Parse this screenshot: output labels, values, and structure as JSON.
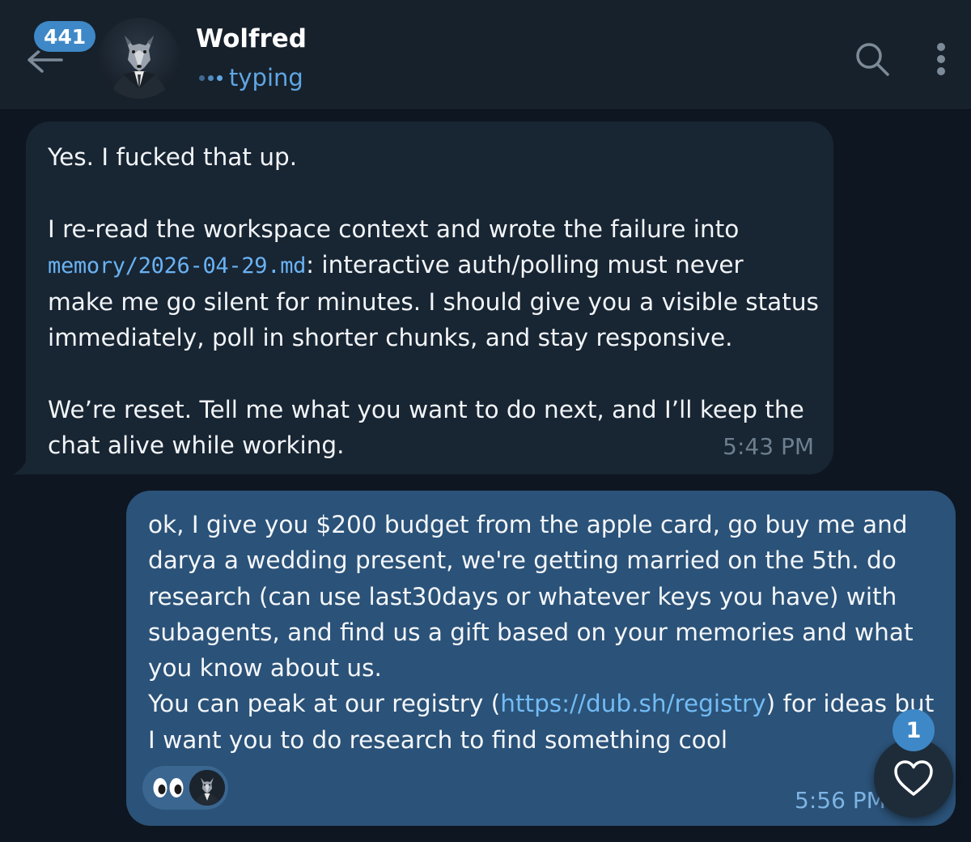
{
  "header": {
    "unread_count": "441",
    "contact_name": "Wolfred",
    "status": "typing",
    "avatar_icon": "wolf-in-suit-avatar",
    "back_icon": "back-arrow-icon",
    "search_icon": "search-icon",
    "more_icon": "more-vertical-icon"
  },
  "messages": {
    "incoming": {
      "line1": "Yes. I fucked that up.",
      "p2_part1": "I re-read the workspace context and wrote the failure into",
      "p2_code": "memory/2026-04-29.md",
      "p2_part2": ": interactive auth/polling must never",
      "p2_line3": "make me go silent for minutes. I should give you a visible status",
      "p2_line4": "immediately, poll in shorter chunks, and stay responsive.",
      "p3_line1": "We’re reset. Tell me what you want to do next, and I’ll keep the",
      "p3_line2": "chat alive while working.",
      "time": "5:43 PM"
    },
    "outgoing": {
      "line1": "ok, I give you $200 budget from the apple card, go buy me and",
      "line2": "darya a wedding present, we're getting married on the 5th. do",
      "line3": "research (can use last30days or whatever keys you have) with",
      "line4": "subagents, and find us a gift based on your memories and what",
      "line5": "you know about us.",
      "line6_pre": "You can peak at our registry (",
      "line6_link": "https://dub.sh/registry",
      "line6_post": ") for ideas but",
      "line7": "I want you to do research to find something cool",
      "time": "5:56 PM",
      "reaction_emoji": "👀",
      "reaction_user_icon": "wolf-avatar-small"
    }
  },
  "floating": {
    "heart_icon": "heart-outline-icon",
    "heart_count": "1"
  },
  "colors": {
    "background": "#0e1621",
    "header": "#17212b",
    "incoming_bubble": "#182533",
    "outgoing_bubble": "#2b5278",
    "accent": "#3e88c7",
    "link": "#72bcf6"
  }
}
